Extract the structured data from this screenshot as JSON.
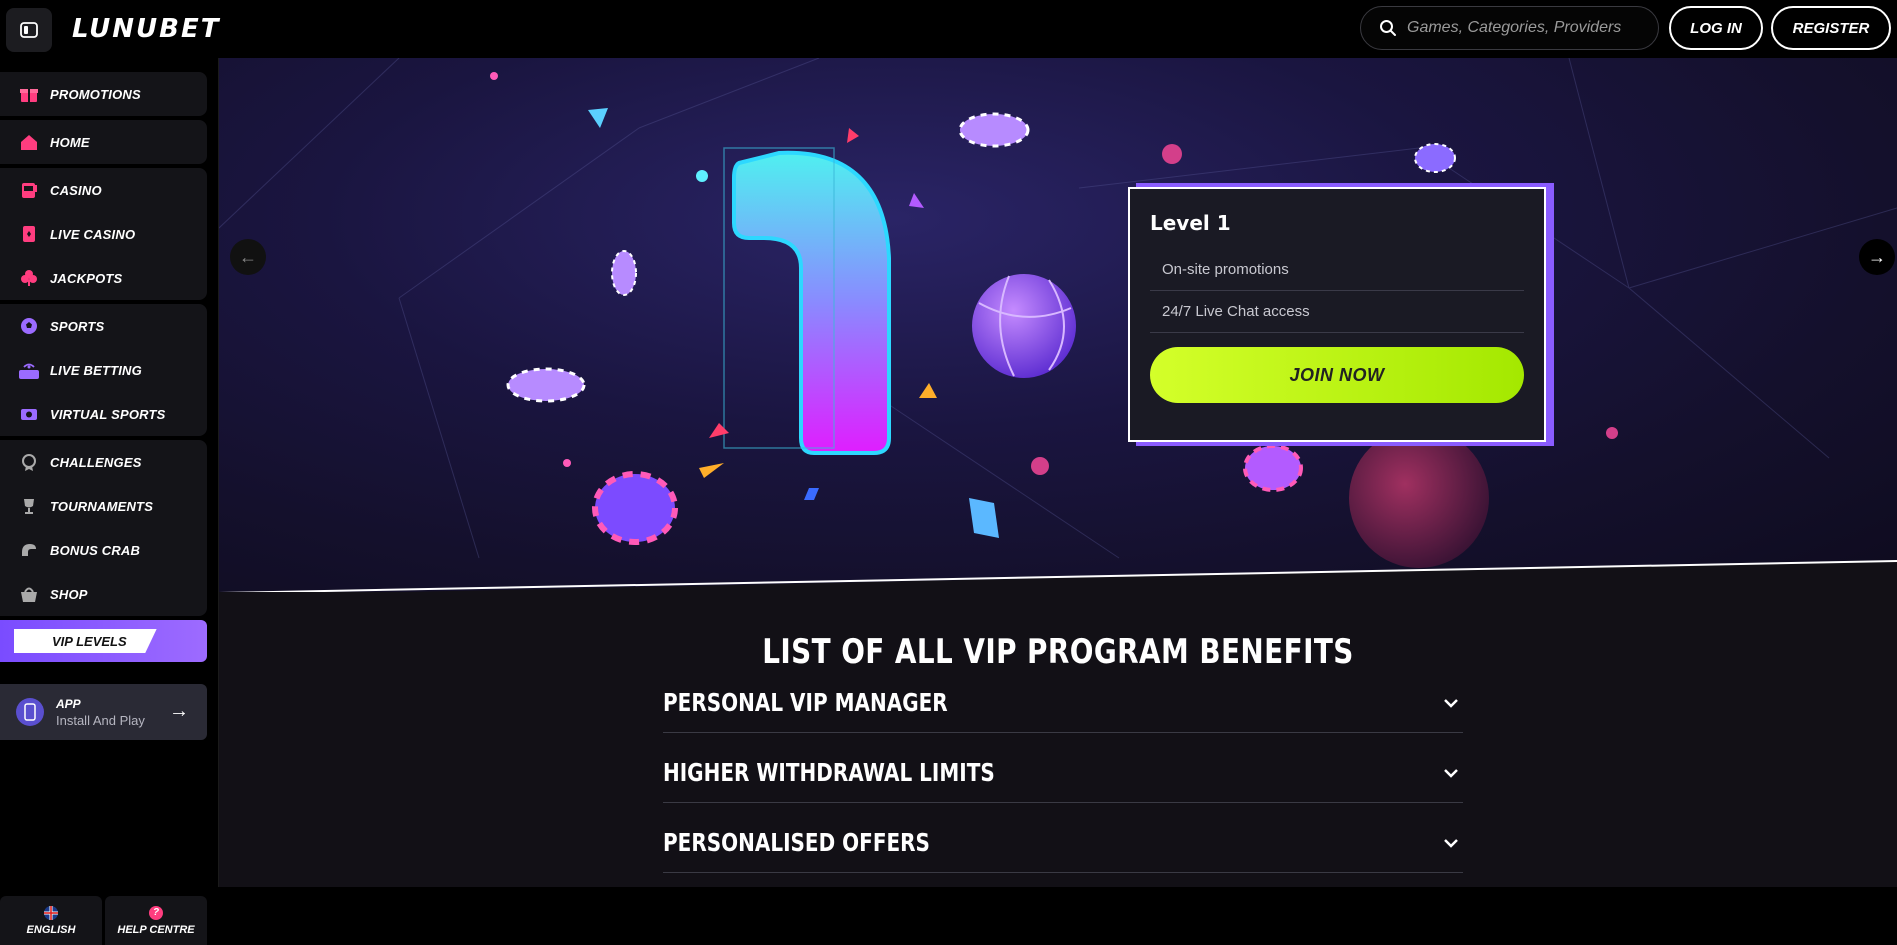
{
  "header": {
    "logo_text": "LUNUBET",
    "search_placeholder": "Games, Categories, Providers",
    "login_label": "LOG IN",
    "register_label": "REGISTER"
  },
  "sidebar": {
    "items": [
      {
        "label": "PROMOTIONS",
        "icon": "gift-icon"
      },
      {
        "label": "HOME",
        "icon": "home-icon"
      },
      {
        "label": "CASINO",
        "icon": "slot-machine-icon"
      },
      {
        "label": "LIVE CASINO",
        "icon": "card-icon"
      },
      {
        "label": "JACKPOTS",
        "icon": "clover-icon"
      },
      {
        "label": "SPORTS",
        "icon": "soccer-ball-icon"
      },
      {
        "label": "LIVE BETTING",
        "icon": "live-icon"
      },
      {
        "label": "VIRTUAL SPORTS",
        "icon": "gamepad-icon"
      },
      {
        "label": "CHALLENGES",
        "icon": "medal-icon"
      },
      {
        "label": "TOURNAMENTS",
        "icon": "trophy-icon"
      },
      {
        "label": "BONUS CRAB",
        "icon": "claw-icon"
      },
      {
        "label": "SHOP",
        "icon": "basket-icon"
      }
    ],
    "vip_label": "VIP LEVELS",
    "app_title": "APP",
    "app_subtitle": "Install And Play",
    "language_label": "ENGLISH",
    "help_label": "HELP CENTRE"
  },
  "hero": {
    "level_title": "Level 1",
    "benefits": [
      "On-site promotions",
      "24/7 Live Chat access"
    ],
    "join_label": "JOIN NOW"
  },
  "benefits_section": {
    "title": "LIST OF ALL VIP PROGRAM BENEFITS",
    "rows": [
      "PERSONAL VIP MANAGER",
      "HIGHER WITHDRAWAL LIMITS",
      "PERSONALISED OFFERS"
    ]
  },
  "colors": {
    "accent_green": "#c6f51a",
    "accent_purple": "#8a5cff",
    "icon_pink": "#ff3d7f",
    "icon_purple": "#9b6bff"
  }
}
